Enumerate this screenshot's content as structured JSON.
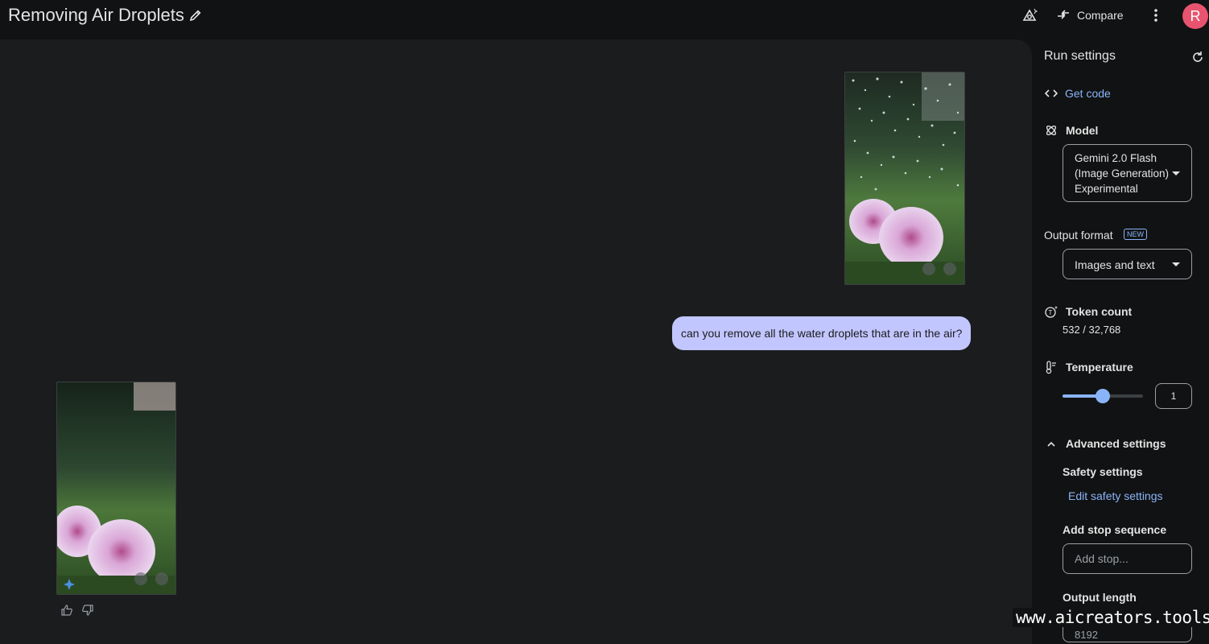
{
  "header": {
    "title": "Removing Air Droplets",
    "compare_label": "Compare",
    "avatar_initial": "R"
  },
  "chat": {
    "user_message": "can you remove all the water droplets that are in the air?"
  },
  "run_settings": {
    "title": "Run settings",
    "get_code": "Get code",
    "model_label": "Model",
    "model_line1": "Gemini 2.0 Flash",
    "model_line2": "(Image Generation)",
    "model_line3": "Experimental",
    "output_format_label": "Output format",
    "new_badge": "NEW",
    "output_format_value": "Images and text",
    "token_count_label": "Token count",
    "token_count_value": "532 / 32,768",
    "temperature_label": "Temperature",
    "temperature_value": "1",
    "temperature_fraction": 0.5,
    "advanced_settings_label": "Advanced settings",
    "safety_settings_label": "Safety settings",
    "edit_safety_link": "Edit safety settings",
    "stop_sequence_label": "Add stop sequence",
    "stop_placeholder": "Add stop...",
    "output_length_label": "Output length",
    "output_length_value": "8192"
  },
  "watermark": "www.aicreators.tools",
  "colors": {
    "accent": "#8ab4f8",
    "user_bubble": "#c2c6ff",
    "avatar": "#e8546f"
  }
}
